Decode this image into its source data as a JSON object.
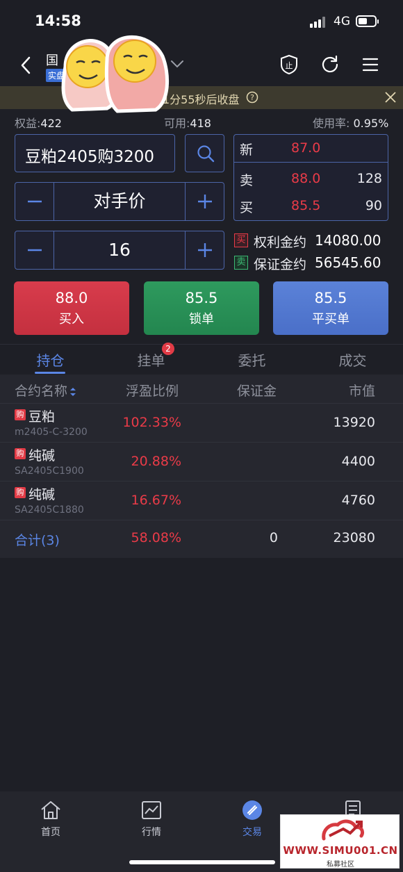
{
  "status_bar": {
    "time": "14:58",
    "network": "4G",
    "battery_level": 0.55
  },
  "nav": {
    "title": "国",
    "account_tag": "实盘"
  },
  "notice": {
    "text": "1分55秒后收盘",
    "icons": [
      "help-icon",
      "close-icon"
    ]
  },
  "account": {
    "equity_label": "权益:",
    "equity": "422",
    "available_label": "可用:",
    "available": "418",
    "usage_label": "使用率:",
    "usage": "0.95%"
  },
  "order": {
    "contract": "豆粕2405购3200",
    "price_type": "对手价",
    "quantity": "16"
  },
  "quote": {
    "last_label": "新",
    "last": "87.0",
    "ask_label": "卖",
    "ask": "88.0",
    "ask_vol": "128",
    "bid_label": "买",
    "bid": "85.5",
    "bid_vol": "90"
  },
  "contract_info": {
    "buy_tag": "买",
    "premium_label": "权利金约",
    "premium": "14080.00",
    "sell_tag": "卖",
    "margin_label": "保证金约",
    "margin": "56545.60"
  },
  "actions": {
    "buy": {
      "price": "88.0",
      "label": "买入"
    },
    "lock": {
      "price": "85.5",
      "label": "锁单"
    },
    "close": {
      "price": "85.5",
      "label": "平买单"
    }
  },
  "tabs": {
    "items": [
      "持仓",
      "挂单",
      "委托",
      "成交"
    ],
    "active": 0,
    "pending_badge": "2"
  },
  "positions": {
    "headers": [
      "合约名称",
      "浮盈比例",
      "保证金",
      "市值"
    ],
    "rows": [
      {
        "tag": "购",
        "name": "豆粕",
        "code": "m2405-C-3200",
        "pct": "102.33%",
        "value": "13920"
      },
      {
        "tag": "购",
        "name": "纯碱",
        "code": "SA2405C1900",
        "pct": "20.88%",
        "value": "4400"
      },
      {
        "tag": "购",
        "name": "纯碱",
        "code": "SA2405C1880",
        "pct": "16.67%",
        "value": "4760"
      }
    ],
    "total": {
      "label": "合计(3)",
      "pct": "58.08%",
      "margin": "0",
      "value": "23080"
    }
  },
  "bottom_nav": {
    "items": [
      {
        "label": "首页",
        "icon": "home-icon"
      },
      {
        "label": "行情",
        "icon": "chart-icon"
      },
      {
        "label": "交易",
        "icon": "trade-icon"
      },
      {
        "label": "",
        "icon": "document-icon"
      }
    ],
    "active": 2
  },
  "watermark": {
    "site": "WWW.SIMU001.CN",
    "sub": "私募社区"
  },
  "colors": {
    "up": "#ea3b48",
    "down": "#3cba74",
    "accent": "#5b86e5",
    "background": "#1e1f26"
  }
}
